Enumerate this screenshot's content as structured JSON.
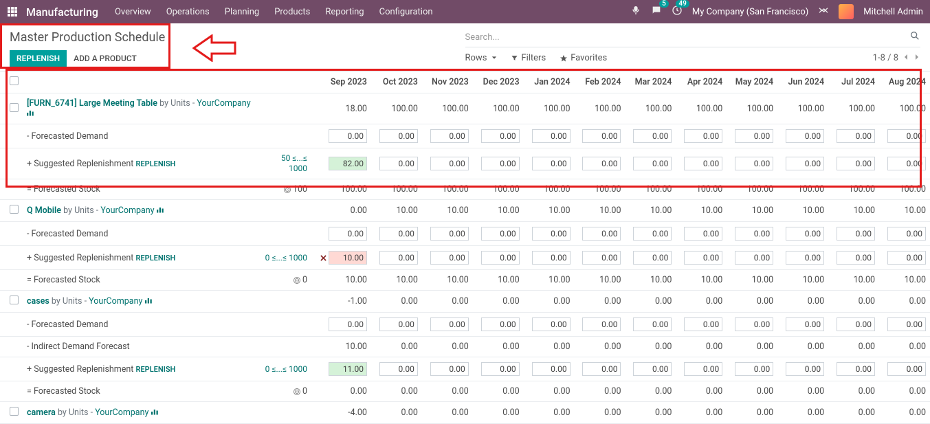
{
  "nav": {
    "brand": "Manufacturing",
    "links": [
      "Overview",
      "Operations",
      "Planning",
      "Products",
      "Reporting",
      "Configuration"
    ],
    "chat_badge": "5",
    "clock_badge": "49",
    "company": "My Company (San Francisco)",
    "user": "Mitchell Admin"
  },
  "cp": {
    "title": "Master Production Schedule",
    "replenish": "REPLENISH",
    "add_product": "ADD A PRODUCT",
    "search_placeholder": "Search...",
    "rows": "Rows",
    "filters": "Filters",
    "favorites": "Favorites",
    "pager": "1-8 / 8"
  },
  "periods": [
    "Sep 2023",
    "Oct 2023",
    "Nov 2023",
    "Dec 2023",
    "Jan 2024",
    "Feb 2024",
    "Mar 2024",
    "Apr 2024",
    "May 2024",
    "Jun 2024",
    "Jul 2024",
    "Aug 2024"
  ],
  "labels": {
    "by_units": "by Units",
    "fdemand": "- Forecasted Demand",
    "idemand": "- Indirect Demand Forecast",
    "sug": "+ Suggested Replenishment",
    "repl": "REPLENISH",
    "fstock": "= Forecasted Stock"
  },
  "products": [
    {
      "name_code": "[FURN_6741] Large Meeting Table",
      "company": "YourCompany",
      "minmax": "50 ≤...≤ 1000",
      "starting": [
        "18.00",
        "100.00",
        "100.00",
        "100.00",
        "100.00",
        "100.00",
        "100.00",
        "100.00",
        "100.00",
        "100.00",
        "100.00",
        "100.00"
      ],
      "fdemand_inputs": [
        "0.00",
        "0.00",
        "0.00",
        "0.00",
        "0.00",
        "0.00",
        "0.00",
        "0.00",
        "0.00",
        "0.00",
        "0.00",
        "0.00"
      ],
      "sug_inputs": [
        "82.00",
        "0.00",
        "0.00",
        "0.00",
        "0.00",
        "0.00",
        "0.00",
        "0.00",
        "0.00",
        "0.00",
        "0.00",
        "0.00"
      ],
      "sug_class": [
        "green",
        "",
        "",
        "",
        "",
        "",
        "",
        "",
        "",
        "",
        "",
        ""
      ],
      "target": "100",
      "fstock": [
        "100.00",
        "100.00",
        "100.00",
        "100.00",
        "100.00",
        "100.00",
        "100.00",
        "100.00",
        "100.00",
        "100.00",
        "100.00",
        "100.00"
      ]
    },
    {
      "name_code": "Q Mobile",
      "company": "YourCompany",
      "minmax": "0 ≤...≤ 1000",
      "starting": [
        "0.00",
        "10.00",
        "10.00",
        "10.00",
        "10.00",
        "10.00",
        "10.00",
        "10.00",
        "10.00",
        "10.00",
        "10.00",
        "10.00"
      ],
      "fdemand_inputs": [
        "0.00",
        "0.00",
        "0.00",
        "0.00",
        "0.00",
        "0.00",
        "0.00",
        "0.00",
        "0.00",
        "0.00",
        "0.00",
        "0.00"
      ],
      "sug_inputs": [
        "10.00",
        "0.00",
        "0.00",
        "0.00",
        "0.00",
        "0.00",
        "0.00",
        "0.00",
        "0.00",
        "0.00",
        "0.00",
        "0.00"
      ],
      "sug_class": [
        "red",
        "",
        "",
        "",
        "",
        "",
        "",
        "",
        "",
        "",
        "",
        ""
      ],
      "sug_x": true,
      "target": "0",
      "fstock": [
        "10.00",
        "10.00",
        "10.00",
        "10.00",
        "10.00",
        "10.00",
        "10.00",
        "10.00",
        "10.00",
        "10.00",
        "10.00",
        "10.00"
      ]
    },
    {
      "name_code": "cases",
      "company": "YourCompany",
      "minmax": "0 ≤...≤ 1000",
      "starting": [
        "-1.00",
        "0.00",
        "0.00",
        "0.00",
        "0.00",
        "0.00",
        "0.00",
        "0.00",
        "0.00",
        "0.00",
        "0.00",
        "0.00"
      ],
      "fdemand_inputs": [
        "0.00",
        "0.00",
        "0.00",
        "0.00",
        "0.00",
        "0.00",
        "0.00",
        "0.00",
        "0.00",
        "0.00",
        "0.00",
        "0.00"
      ],
      "indirect": [
        "10.00",
        "0.00",
        "0.00",
        "0.00",
        "0.00",
        "0.00",
        "0.00",
        "0.00",
        "0.00",
        "0.00",
        "0.00",
        "0.00"
      ],
      "sug_inputs": [
        "11.00",
        "0.00",
        "0.00",
        "0.00",
        "0.00",
        "0.00",
        "0.00",
        "0.00",
        "0.00",
        "0.00",
        "0.00",
        "0.00"
      ],
      "sug_class": [
        "green",
        "",
        "",
        "",
        "",
        "",
        "",
        "",
        "",
        "",
        "",
        ""
      ],
      "target": "0",
      "fstock": [
        "0.00",
        "0.00",
        "0.00",
        "0.00",
        "0.00",
        "0.00",
        "0.00",
        "0.00",
        "0.00",
        "0.00",
        "0.00",
        "0.00"
      ]
    },
    {
      "name_code": "camera",
      "company": "YourCompany",
      "starting": [
        "-4.00",
        "0.00",
        "0.00",
        "0.00",
        "0.00",
        "0.00",
        "0.00",
        "0.00",
        "0.00",
        "0.00",
        "0.00",
        "0.00"
      ]
    }
  ]
}
